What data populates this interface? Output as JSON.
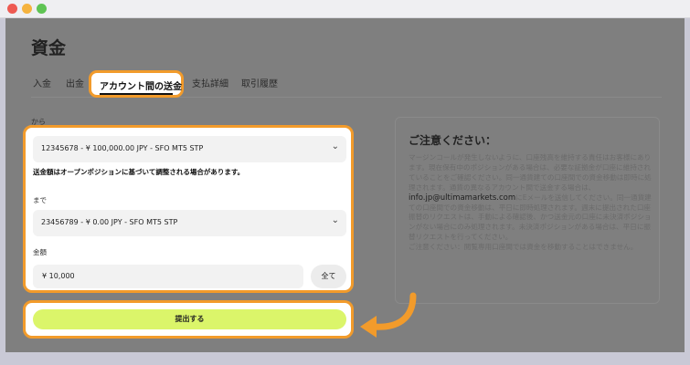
{
  "page": {
    "title": "資金"
  },
  "tabs": [
    {
      "label": "入金"
    },
    {
      "label": "出金"
    },
    {
      "label": "アカウント間の送金"
    },
    {
      "label": "支払詳細"
    },
    {
      "label": "取引履歴"
    }
  ],
  "form": {
    "from_label": "から",
    "from_account": "12345678 - ¥ 100,000.00 JPY - SFO MT5 STP",
    "notice": "送金額はオープンポジションに基づいて調整される場合があります。",
    "to_label": "まで",
    "to_account": "23456789 - ¥ 0.00 JPY - SFO MT5 STP",
    "amount_label": "金額",
    "amount_value": "¥ 10,000",
    "all_button": "全て",
    "submit_button": "提出する"
  },
  "notes": {
    "title": "ご注意ください：",
    "para1": "マージンコールが発生しないように、口座残高を維持する責任はお客様にあります。現在保有中のポジションがある場合は、必要な証拠金が口座に維持されていることをご確認ください。同一通貨建ての口座間での資金移動は即時に処理されます。通貨の異なるアカウント間で送金する場合は、",
    "email": "info.jp@ultimamarkets.com",
    "para2": "にEメールを送信してください。同一通貨建ての口座間での資金移動は、平日に即時処理されます。週末に提出された口座振替のリクエストは、手動による確認後、かつ送金元の口座に未決済ポジションがない場合にのみ処理されます。未決済ポジションがある場合は、平日に振替リクエストを行ってください。",
    "para3": "ご注意ください：閲覧専用口座間では資金を移動することはできません。"
  },
  "icons": {
    "chevron": "chevron-down-icon",
    "arrow": "curved-arrow-icon"
  },
  "colors": {
    "highlight": "#f29b2b",
    "submit": "#dbf56a",
    "overlay": "#7f7f7f"
  }
}
